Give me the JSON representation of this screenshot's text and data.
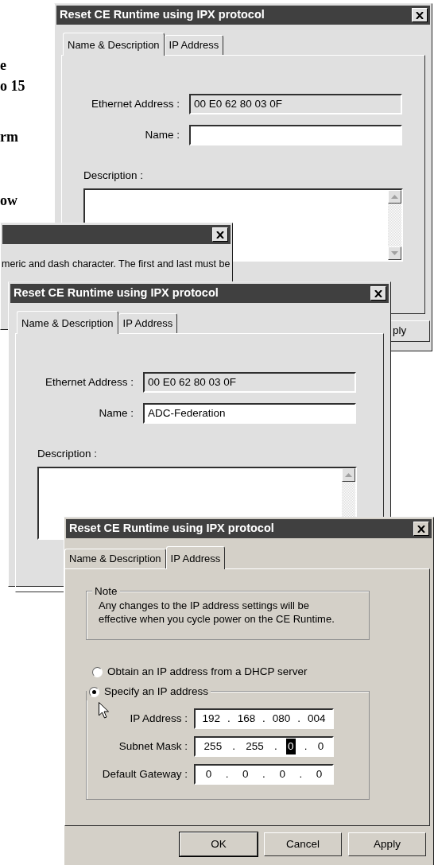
{
  "background_text": [
    "e",
    "o 15",
    "rm",
    "ow"
  ],
  "windows": [
    {
      "kind": "property_sheet",
      "title": "Reset CE Runtime using IPX protocol",
      "tabs": [
        {
          "label": "Name & Description",
          "selected": true
        },
        {
          "label": "IP Address",
          "selected": false
        }
      ],
      "ethernet_label": "Ethernet Address :",
      "ethernet_value": "00 E0 62 80 03 0F",
      "name_label": "Name :",
      "description_label": "Description :",
      "buttons": [
        "ply"
      ]
    },
    {
      "kind": "message",
      "message": "meric and dash character. The first and last must be"
    },
    {
      "kind": "property_sheet",
      "title": "Reset CE Runtime using IPX protocol",
      "tabs": [
        {
          "label": "Name & Description",
          "selected": true
        },
        {
          "label": "IP Address",
          "selected": false
        }
      ],
      "ethernet_label": "Ethernet Address :",
      "ethernet_value": "00 E0 62 80 03 0F",
      "name_label": "Name :",
      "name_value": "ADC-Federation",
      "description_label": "Description :"
    },
    {
      "kind": "ip_sheet",
      "title": "Reset CE Runtime using IPX protocol",
      "tabs": [
        {
          "label": "Name & Description",
          "selected": false
        },
        {
          "label": "IP Address",
          "selected": true
        }
      ],
      "note_label": "Note",
      "note_text": "Any changes to the IP address settings will be effective when you cycle power on the CE Runtime.",
      "radios": [
        {
          "label": "Obtain an IP address from a DHCP server",
          "selected": false
        },
        {
          "label": "Specify an IP address",
          "selected": true
        }
      ],
      "fields": [
        {
          "label": "IP Address :",
          "parts": [
            {
              "text": "192",
              "selected": false
            },
            {
              "text": ".",
              "selected": false
            },
            {
              "text": "168",
              "selected": false
            },
            {
              "text": ".",
              "selected": false
            },
            {
              "text": "080",
              "selected": false
            },
            {
              "text": ".",
              "selected": false
            },
            {
              "text": "004",
              "selected": false
            }
          ]
        },
        {
          "label": "Subnet Mask :",
          "parts": [
            {
              "text": "255",
              "selected": false
            },
            {
              "text": ".",
              "selected": false
            },
            {
              "text": "255",
              "selected": false
            },
            {
              "text": ".",
              "selected": false
            },
            {
              "text": "0",
              "selected": true
            },
            {
              "text": ".",
              "selected": false
            },
            {
              "text": "0",
              "selected": false
            }
          ]
        },
        {
          "label": "Default Gateway :",
          "parts": [
            {
              "text": "0",
              "selected": false
            },
            {
              "text": ".",
              "selected": false
            },
            {
              "text": "0",
              "selected": false
            },
            {
              "text": ".",
              "selected": false
            },
            {
              "text": "0",
              "selected": false
            },
            {
              "text": ".",
              "selected": false
            },
            {
              "text": "0",
              "selected": false
            }
          ]
        }
      ],
      "buttons": [
        "OK",
        "Cancel",
        "Apply"
      ]
    }
  ]
}
